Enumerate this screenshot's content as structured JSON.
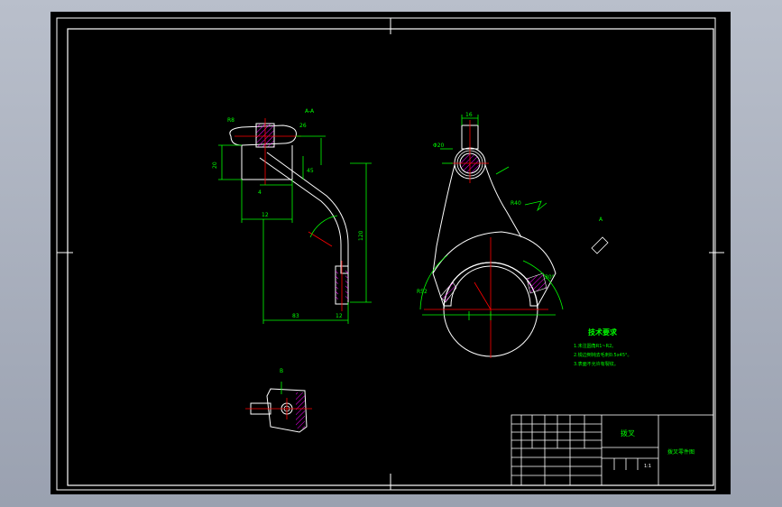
{
  "drawing": {
    "title_block": {
      "part_name": "拨叉",
      "drawing_title": "拨叉零件图",
      "scale": "1:1"
    },
    "technical_requirements": {
      "heading": "技术要求",
      "lines": [
        "1.未注圆角R1~R2。",
        "2.锐边倒钝去毛刺0.5x45°。",
        "3.表面不允许有裂纹。"
      ]
    },
    "view_labels": {
      "section_view": "A-A",
      "detail_view": "B",
      "side_view": "A"
    },
    "dimension_labels": {
      "d_r8": "R8",
      "d_26": "26",
      "d_20": "20",
      "d_12": "12",
      "d_4": "4",
      "d_45": "45",
      "d_height": "120",
      "d_width": "83",
      "d_12b": "12",
      "d_phi": "Φ20",
      "d_r": "R40",
      "d_r2": "R52",
      "d_ang": "30°",
      "d_16": "16"
    }
  },
  "colors": {
    "background": "#000000",
    "outline": "#ffffff",
    "dimension": "#00ff00",
    "centerline": "#ff0000",
    "hatch": "#ff00ff"
  }
}
